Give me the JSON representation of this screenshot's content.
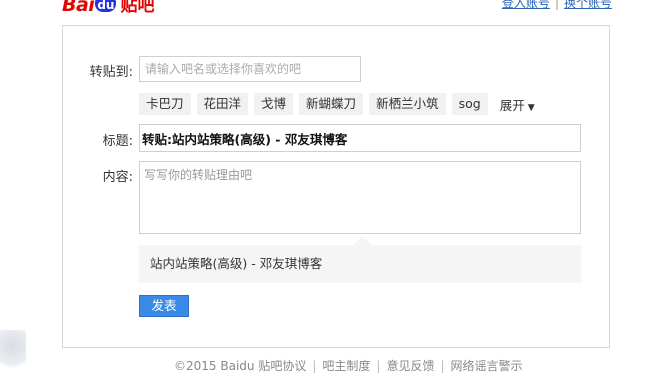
{
  "header": {
    "logo": {
      "bai": "Bai",
      "du": "du",
      "tieba": "贴吧"
    },
    "links": [
      "登入账号",
      "换个账号"
    ]
  },
  "form": {
    "forum_label": "转贴到:",
    "forum_placeholder": "请输入吧名或选择你喜欢的吧",
    "tags": [
      "卡巴刀",
      "花田洋",
      "戈博",
      "新蝴蝶刀",
      "新栖兰小筑",
      "sog"
    ],
    "expand_label": "展开",
    "title_label": "标题:",
    "title_value": "转贴:站内站策略(高级) - 邓友琪博客",
    "content_label": "内容:",
    "content_placeholder": "写写你的转贴理由吧",
    "quote_text": "站内站策略(高级) - 邓友琪博客",
    "submit_label": "发表"
  },
  "footer": {
    "copyright": "©2015 Baidu",
    "links": [
      "贴吧协议",
      "吧主制度",
      "意见反馈",
      "网络谣言警示"
    ]
  }
}
